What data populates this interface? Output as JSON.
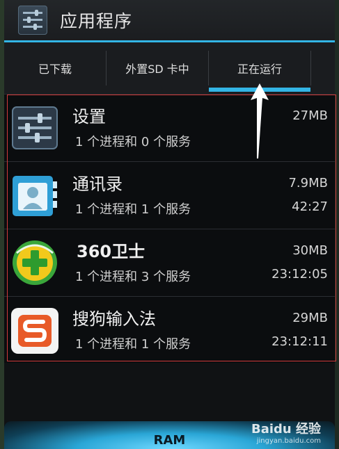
{
  "action_bar": {
    "title": "应用程序"
  },
  "tabs": [
    {
      "label": "已下载"
    },
    {
      "label": "外置SD 卡中"
    },
    {
      "label": "正在运行"
    }
  ],
  "apps": [
    {
      "name": "设置",
      "desc": "1 个进程和 0 个服务",
      "size": "27MB",
      "time": "",
      "icon": "settings-icon"
    },
    {
      "name": "通讯录",
      "desc": "1 个进程和 1 个服务",
      "size": "7.9MB",
      "time": "42:27",
      "icon": "contacts-icon"
    },
    {
      "name": "360卫士",
      "desc": "1 个进程和 3 个服务",
      "size": "30MB",
      "time": "23:12:05",
      "icon": "360-security-icon"
    },
    {
      "name": "搜狗输入法",
      "desc": "1 个进程和 1 个服务",
      "size": "29MB",
      "time": "23:12:11",
      "icon": "sogou-input-icon"
    }
  ],
  "bottom": {
    "ram_label": "RAM"
  },
  "watermark": {
    "top": "Baidu 经验",
    "bottom": "jingyan.baidu.com"
  },
  "colors": {
    "accent": "#33b5e5",
    "highlight_box": "#d23a3a"
  }
}
